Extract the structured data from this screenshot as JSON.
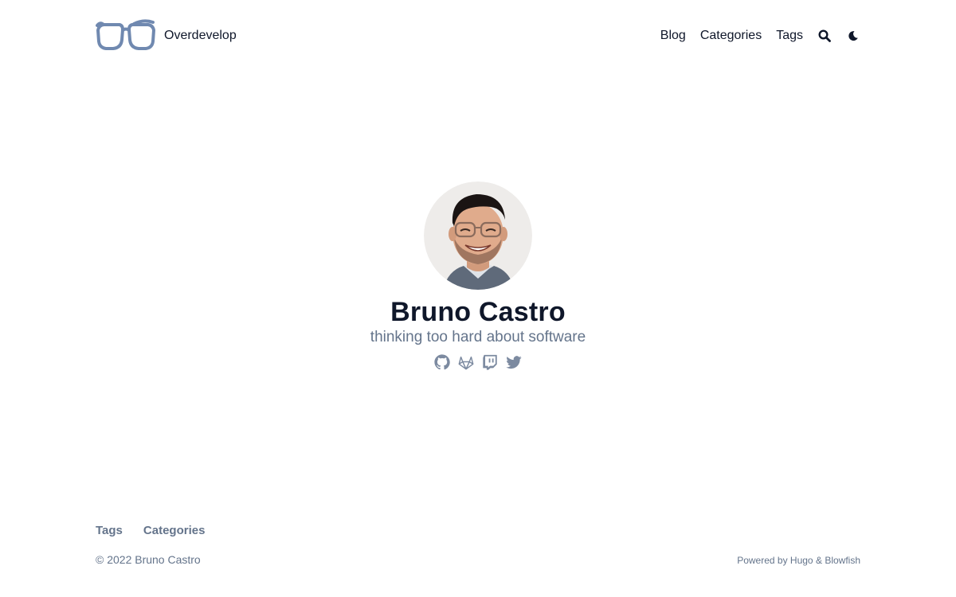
{
  "header": {
    "site_name": "Overdevelop",
    "nav": {
      "blog": "Blog",
      "categories": "Categories",
      "tags": "Tags"
    },
    "icons": {
      "logo": "glasses-logo",
      "search": "search-icon",
      "theme": "moon-icon"
    }
  },
  "profile": {
    "name": "Bruno Castro",
    "tagline": "thinking too hard about software",
    "avatar_alt": "Bruno Castro",
    "socials": [
      {
        "icon": "github-icon"
      },
      {
        "icon": "gitlab-icon"
      },
      {
        "icon": "twitch-icon"
      },
      {
        "icon": "twitter-icon"
      }
    ]
  },
  "footer": {
    "nav": {
      "tags": "Tags",
      "categories": "Categories"
    },
    "copyright": "© 2022 Bruno Castro",
    "powered_prefix": "Powered by",
    "hugo": "Hugo",
    "amp": "&",
    "blowfish": "Blowfish"
  },
  "colors": {
    "text_primary": "#0f172a",
    "text_muted": "#64748b",
    "background": "#ffffff",
    "logo_blue": "#7089b0"
  }
}
